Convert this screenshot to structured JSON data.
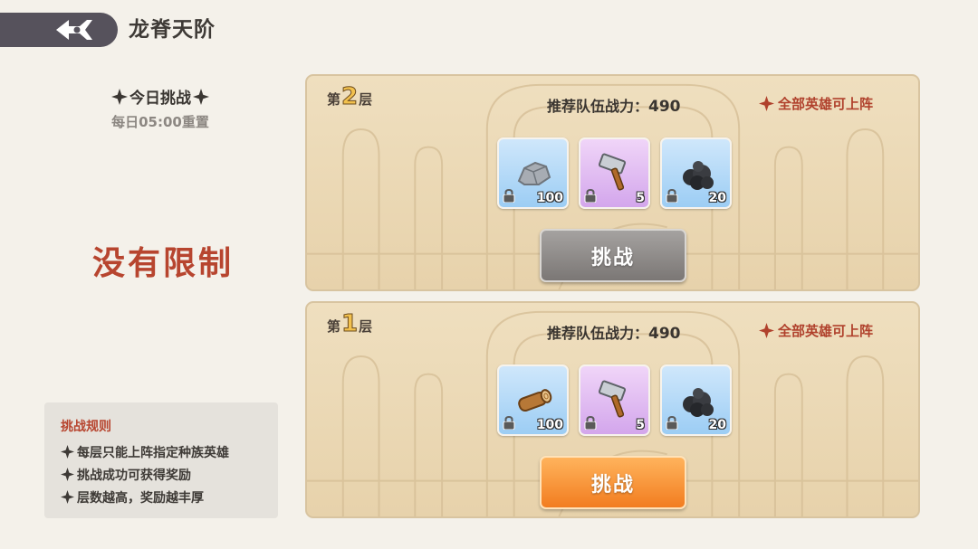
{
  "header": {
    "title": "龙脊天阶"
  },
  "left_panel": {
    "daily_title": "今日挑战",
    "daily_reset": "每日05:00重置",
    "restriction": "没有限制",
    "rules": {
      "title": "挑战规则",
      "items": [
        "每层只能上阵指定种族英雄",
        "挑战成功可获得奖励",
        "层数越高，奖励越丰厚"
      ]
    }
  },
  "floors": [
    {
      "prefix": "第",
      "number": "2",
      "suffix": "层",
      "power_label": "推荐队伍战力：",
      "power_value": "490",
      "heroes_note": "全部英雄可上阵",
      "rewards": [
        {
          "icon": "stone-ore-icon",
          "count": "100",
          "rarity": "blue"
        },
        {
          "icon": "hammer-icon",
          "count": "5",
          "rarity": "purple"
        },
        {
          "icon": "coal-icon",
          "count": "20",
          "rarity": "blue"
        }
      ],
      "button_label": "挑战",
      "button_state": "locked"
    },
    {
      "prefix": "第",
      "number": "1",
      "suffix": "层",
      "power_label": "推荐队伍战力：",
      "power_value": "490",
      "heroes_note": "全部英雄可上阵",
      "rewards": [
        {
          "icon": "wood-log-icon",
          "count": "100",
          "rarity": "blue"
        },
        {
          "icon": "hammer-icon",
          "count": "5",
          "rarity": "purple"
        },
        {
          "icon": "coal-icon",
          "count": "20",
          "rarity": "blue"
        }
      ],
      "button_label": "挑战",
      "button_state": "available"
    }
  ],
  "colors": {
    "accent_red": "#b7452f",
    "button_orange": "#f27d20",
    "button_gray": "#7b7775"
  }
}
